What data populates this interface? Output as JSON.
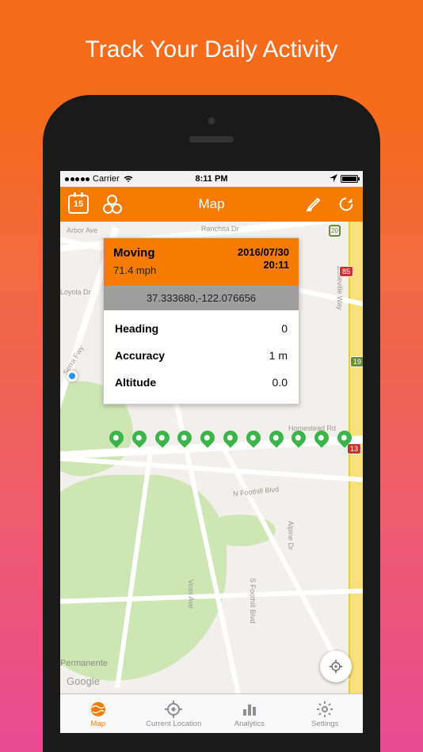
{
  "marketing": {
    "headline": "Track Your Daily Activity"
  },
  "statusbar": {
    "carrier": "Carrier",
    "time": "8:11 PM"
  },
  "navbar": {
    "title": "Map",
    "calendar_day": "15"
  },
  "card": {
    "status": "Moving",
    "speed": "71.4 mph",
    "date": "2016/07/30",
    "time": "20:11",
    "coords": "37.333680,-122.076656",
    "rows": [
      {
        "k": "Heading",
        "v": "0"
      },
      {
        "k": "Accuracy",
        "v": "1 m"
      },
      {
        "k": "Altitude",
        "v": "0.0"
      }
    ]
  },
  "map": {
    "attribution": "Google",
    "labels": {
      "arbor": "Arbor Ave",
      "ranchita": "Ranchita Dr",
      "loyola": "Loyola Dr",
      "serra": "Serra Fwy",
      "belleville": "Belleville Way",
      "foothill": "N Foothill Blvd",
      "voss": "Voss Ave",
      "sfoothill": "S Foothill Blvd",
      "alpine": "Alpine Dr",
      "homestead": "Homestead Rd",
      "permanente": "Permanente"
    },
    "badges": {
      "b85": "85",
      "b13": "13",
      "b19": "19",
      "b20": "20"
    }
  },
  "tabs": [
    {
      "label": "Map"
    },
    {
      "label": "Current Location"
    },
    {
      "label": "Analytics"
    },
    {
      "label": "Settings"
    }
  ]
}
